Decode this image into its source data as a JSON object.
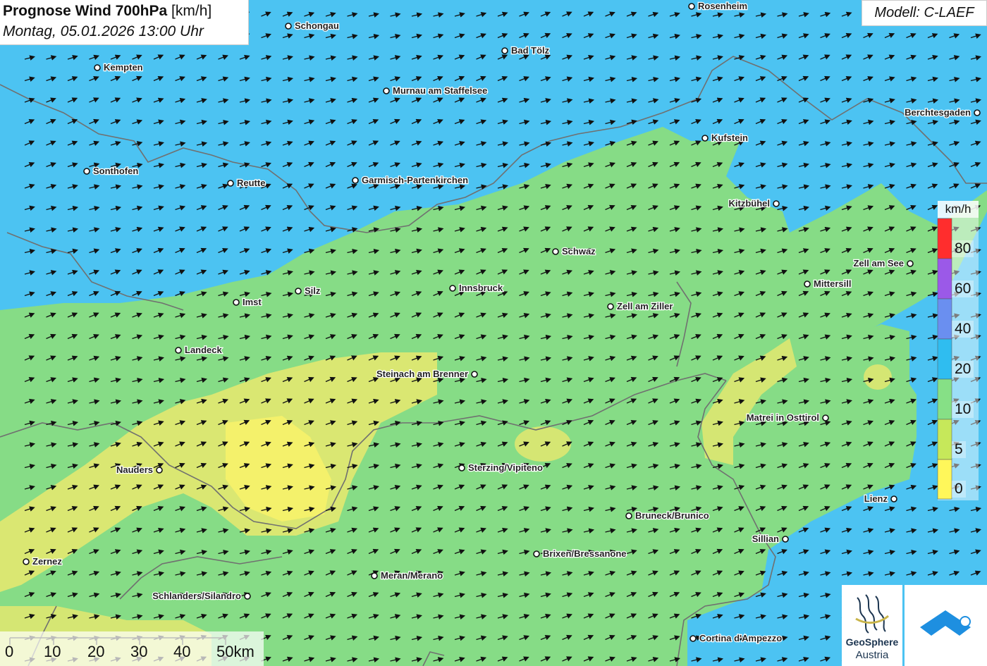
{
  "title": {
    "main": "Prognose Wind 700hPa",
    "unit": "[km/h]",
    "datetime": "Montag, 05.01.2026 13:00 Uhr"
  },
  "model_label": "Modell: C-LAEF",
  "legend": {
    "unit": "km/h",
    "labels": [
      "80",
      "60",
      "40",
      "20",
      "10",
      "5",
      "0"
    ],
    "colors": [
      "#ff2d2d",
      "#9b59e8",
      "#6a8ff0",
      "#2fbdf0",
      "#86e086",
      "#c6e85a",
      "#fff75a"
    ]
  },
  "scale_bar": {
    "labels": [
      "0",
      "10",
      "20",
      "30",
      "40",
      "50km"
    ]
  },
  "colors": {
    "high_wind_blue": "#4cc3f2",
    "mid_green": "#86dc86",
    "low_yellow": "#f0ec6c",
    "border_gray": "#707070"
  },
  "cities": [
    {
      "name": "Rosenheim"
    },
    {
      "name": "Schongau"
    },
    {
      "name": "Bad Tölz"
    },
    {
      "name": "Kempten"
    },
    {
      "name": "Murnau am Staffelsee"
    },
    {
      "name": "Berchtesgaden"
    },
    {
      "name": "Kufstein"
    },
    {
      "name": "Sonthofen"
    },
    {
      "name": "Reutte"
    },
    {
      "name": "Garmisch-Partenkirchen"
    },
    {
      "name": "Kitzbühel"
    },
    {
      "name": "Schwaz"
    },
    {
      "name": "Zell am See"
    },
    {
      "name": "Mittersill"
    },
    {
      "name": "Silz"
    },
    {
      "name": "Innsbruck"
    },
    {
      "name": "Imst"
    },
    {
      "name": "Zell am Ziller"
    },
    {
      "name": "Landeck"
    },
    {
      "name": "Steinach am Brenner"
    },
    {
      "name": "Matrei in Osttirol"
    },
    {
      "name": "Nauders"
    },
    {
      "name": "Sterzing/Vipiteno"
    },
    {
      "name": "Lienz"
    },
    {
      "name": "Bruneck/Brunico"
    },
    {
      "name": "Sillian"
    },
    {
      "name": "Brixen/Bressanone"
    },
    {
      "name": "Zernez"
    },
    {
      "name": "Meran/Merano"
    },
    {
      "name": "Schlanders/Silandro"
    },
    {
      "name": "Cortina d'Ampezzo"
    }
  ],
  "logo": {
    "line1": "GeoSphere",
    "line2": "Austria"
  }
}
